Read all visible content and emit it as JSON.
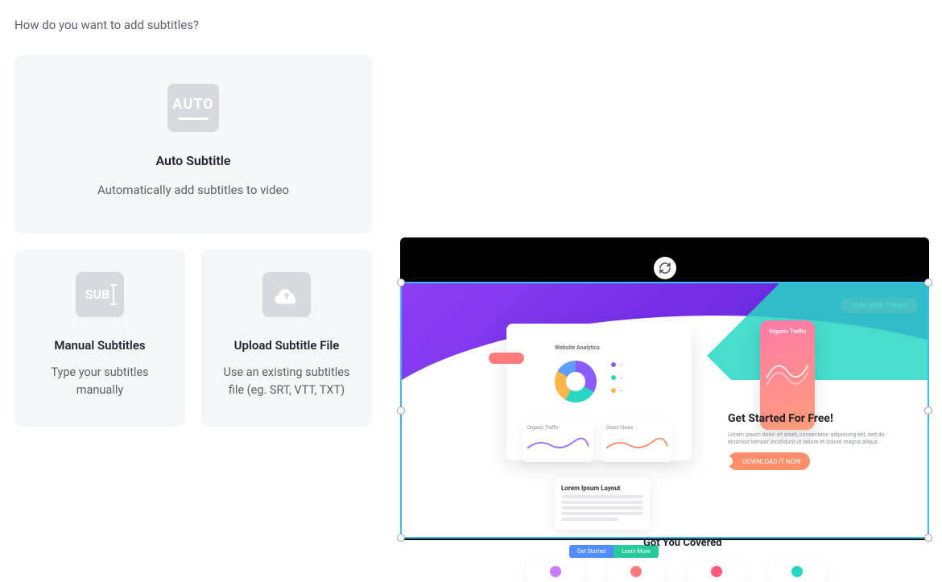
{
  "sidebar": {
    "heading": "How do you want to add subtitles?",
    "options": {
      "auto": {
        "icon_label": "AUTO",
        "title": "Auto Subtitle",
        "desc": "Automatically add subtitles to video"
      },
      "manual": {
        "icon_label": "SUB",
        "title": "Manual Subtitles",
        "desc": "Type your subtitles manually"
      },
      "upload": {
        "title": "Upload Subtitle File",
        "desc": "Use an existing subtitles file (eg. SRT, VTT, TXT)"
      }
    }
  },
  "preview": {
    "hero_button": "JOIN NOW TODAY",
    "dashboard_title": "Website Analytics",
    "phone_title": "Organic Traffic",
    "panel1_title": "Organic Traffic",
    "panel2_title": "Direct Views",
    "right_copy": {
      "heading": "Get Started For Free!",
      "body": "Lorem ipsum dolor sit amet, consectetur adipiscing elit, sed do eiusmod tempor incididunt ut labore et dolore magna aliqua.",
      "button": "DOWNLOAD IT NOW"
    },
    "text_card_title": "Lorem Ipsum Layout",
    "tab_a": "Get Started",
    "tab_b": "Learn More",
    "section_heading": "Got You Covered",
    "chip_colors": [
      "#c87bff",
      "#ff7a7a",
      "#ff5a7a",
      "#27d6c2"
    ]
  },
  "colors": {
    "selection_border": "#38bdf8",
    "card_bg": "#f5f6f7",
    "icon_bg": "#d6d9dd"
  }
}
